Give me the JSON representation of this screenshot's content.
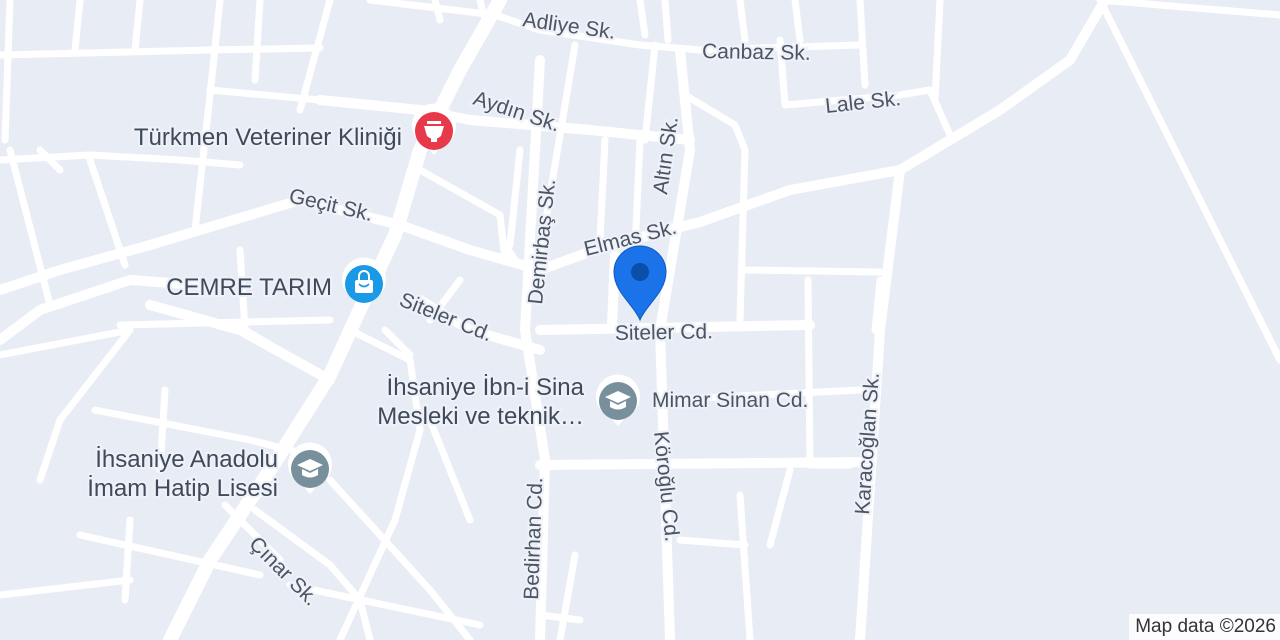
{
  "streets": [
    {
      "name": "Adliye Sk."
    },
    {
      "name": "Canbaz Sk."
    },
    {
      "name": "Lale Sk."
    },
    {
      "name": "Aydın Sk."
    },
    {
      "name": "Altın Sk."
    },
    {
      "name": "Demirbaş Sk."
    },
    {
      "name": "Geçit Sk."
    },
    {
      "name": "Elmas Sk."
    },
    {
      "name": "Siteler Cd."
    },
    {
      "name": "Siteler Cd."
    },
    {
      "name": "Mimar Sinan Cd."
    },
    {
      "name": "Karacoğlan Sk."
    },
    {
      "name": "Bedirhan Cd."
    },
    {
      "name": "Köroğlu Cd."
    },
    {
      "name": "Çınar Sk."
    }
  ],
  "pois": [
    {
      "line1": "Türkmen Veteriner Kliniği",
      "line2": "",
      "icon": "mortar-pestle-icon",
      "color": "#e8394a"
    },
    {
      "line1": "CEMRE TARIM",
      "line2": "",
      "icon": "shopping-bag-icon",
      "color": "#1a9ae6"
    },
    {
      "line1": "İhsaniye İbn-i Sina",
      "line2": "Mesleki ve teknik…",
      "icon": "graduation-cap-icon",
      "color": "#78909c"
    },
    {
      "line1": "İhsaniye Anadolu",
      "line2": "İmam Hatip Lisesi",
      "icon": "graduation-cap-icon",
      "color": "#78909c"
    }
  ],
  "marker": {
    "icon": "location-pin-icon",
    "color": "#1a73e8"
  },
  "attribution": "Map data ©2026"
}
